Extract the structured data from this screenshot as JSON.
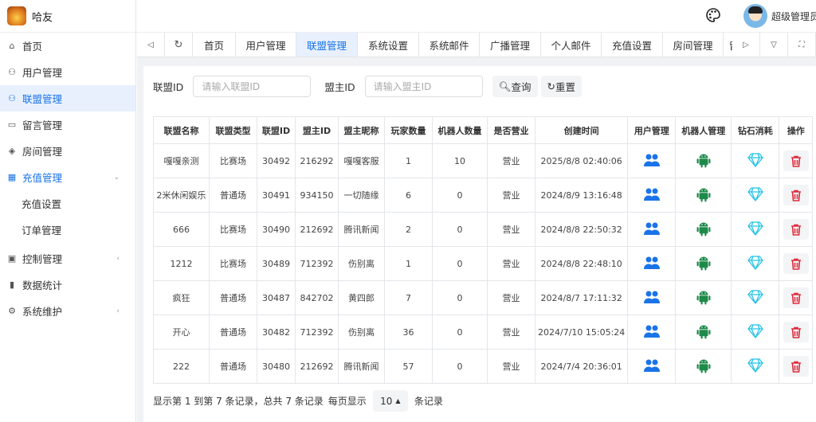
{
  "app": {
    "name": "哈友",
    "user": "超级管理员"
  },
  "sidebar": {
    "items": [
      {
        "label": "首页",
        "icon": "home-icon",
        "glyph": "⌂"
      },
      {
        "label": "用户管理",
        "icon": "user-icon",
        "glyph": "⚇"
      },
      {
        "label": "联盟管理",
        "icon": "users-icon",
        "glyph": "⚇",
        "active": true
      },
      {
        "label": "留言管理",
        "icon": "message-icon",
        "glyph": "▭"
      },
      {
        "label": "房间管理",
        "icon": "diamond-grid-icon",
        "glyph": "◈"
      },
      {
        "label": "充值管理",
        "icon": "recharge-icon",
        "glyph": "▦",
        "open": true,
        "chevron": "⌄"
      },
      {
        "label": "充值设置",
        "sub": true
      },
      {
        "label": "订单管理",
        "sub": true
      },
      {
        "label": "控制管理",
        "icon": "control-icon",
        "glyph": "▣",
        "chevron": "‹"
      },
      {
        "label": "数据统计",
        "icon": "chart-icon",
        "glyph": "▮"
      },
      {
        "label": "系统维护",
        "icon": "gear-icon",
        "glyph": "⚙",
        "chevron": "‹"
      }
    ]
  },
  "tabs": [
    "首页",
    "用户管理",
    "联盟管理",
    "系统设置",
    "系统邮件",
    "广播管理",
    "个人邮件",
    "充值设置",
    "房间管理",
    "留言"
  ],
  "active_tab": "联盟管理",
  "search": {
    "alliance_label": "联盟ID",
    "alliance_placeholder": "请输入联盟ID",
    "owner_label": "盟主ID",
    "owner_placeholder": "请输入盟主ID",
    "query": "查询",
    "reset": "重置"
  },
  "table": {
    "headers": [
      "联盟名称",
      "联盟类型",
      "联盟ID",
      "盟主ID",
      "盟主昵称",
      "玩家数量",
      "机器人数量",
      "是否营业",
      "创建时间",
      "用户管理",
      "机器人管理",
      "钻石消耗",
      "操作"
    ],
    "rows": [
      [
        "嘎嘎亲测",
        "比赛场",
        "30492",
        "216292",
        "嘎嘎客服",
        "1",
        "10",
        "营业",
        "2025/8/8 02:40:06"
      ],
      [
        "2米休闲娱乐",
        "普通场",
        "30491",
        "934150",
        "一切随缘",
        "6",
        "0",
        "营业",
        "2024/8/9 13:16:48"
      ],
      [
        "666",
        "比赛场",
        "30490",
        "212692",
        "腾讯新闻",
        "2",
        "0",
        "营业",
        "2024/8/8 22:50:32"
      ],
      [
        "1212",
        "比赛场",
        "30489",
        "712392",
        "伤别离",
        "1",
        "0",
        "营业",
        "2024/8/8 22:48:10"
      ],
      [
        "疯狂",
        "普通场",
        "30487",
        "842702",
        "黄四郎",
        "7",
        "0",
        "营业",
        "2024/8/7 17:11:32"
      ],
      [
        "开心",
        "普通场",
        "30482",
        "712392",
        "伤别离",
        "36",
        "0",
        "营业",
        "2024/7/10 15:05:24"
      ],
      [
        "222",
        "普通场",
        "30480",
        "212692",
        "腾讯新闻",
        "57",
        "0",
        "营业",
        "2024/7/4 20:36:01"
      ]
    ]
  },
  "footer": {
    "summary": "显示第 1 到第 7 条记录，总共 7 条记录",
    "per_page_prefix": "每页显示",
    "page_size": "10",
    "per_page_suffix": "条记录"
  },
  "colors": {
    "accent": "#1a73e8",
    "android": "#1e8a4a",
    "diamond": "#22c3e6",
    "delete": "#e02b3c"
  }
}
